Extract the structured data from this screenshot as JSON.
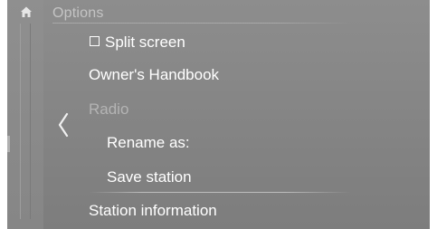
{
  "header": {
    "title": "Options",
    "home_icon": "home-icon"
  },
  "nav": {
    "back_icon": "chevron-left-icon"
  },
  "menu": {
    "split_screen": {
      "label": "Split screen",
      "checked": false
    },
    "owners_handbook": {
      "label": "Owner's Handbook"
    },
    "radio_section": {
      "label": "Radio",
      "enabled": false
    },
    "rename_as": {
      "label": "Rename as:"
    },
    "save_station": {
      "label": "Save station"
    },
    "station_information": {
      "label": "Station information"
    }
  },
  "colors": {
    "background": "#868686",
    "text": "#ffffff",
    "disabled_text": "#b4b4b4",
    "title_text": "#c4c4c4"
  }
}
